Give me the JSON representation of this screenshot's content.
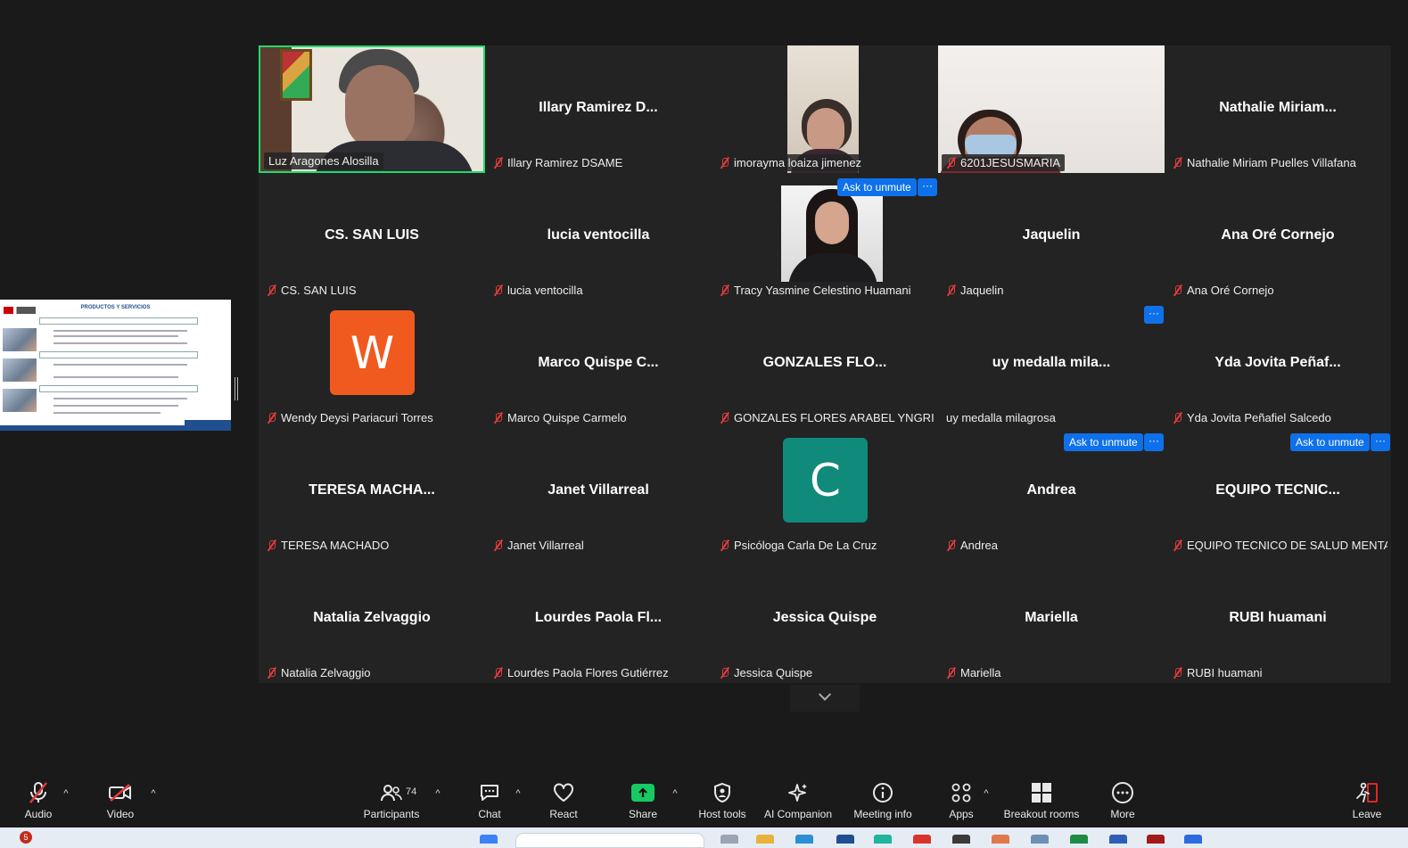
{
  "tiles": [
    {
      "big": "",
      "label": "Luz Aragones Alosilla",
      "muted": false
    },
    {
      "big": "Illary Ramirez D...",
      "label": "Illary Ramirez DSAME",
      "muted": true
    },
    {
      "big": "",
      "label": "imorayma loaiza jimenez",
      "muted": true
    },
    {
      "big": "",
      "label": "6201JESUSMARIA",
      "muted": true
    },
    {
      "big": "Nathalie Miriam...",
      "label": "Nathalie Miriam Puelles Villafana",
      "muted": true
    },
    {
      "big": "CS. SAN LUIS",
      "label": "CS. SAN LUIS",
      "muted": true
    },
    {
      "big": "lucia ventocilla",
      "label": "lucia ventocilla",
      "muted": true
    },
    {
      "big": "",
      "label": "Tracy Yasmine Celestino Huamani",
      "muted": true
    },
    {
      "big": "Jaquelin",
      "label": "Jaquelin",
      "muted": true
    },
    {
      "big": "Ana Oré Cornejo",
      "label": "Ana Oré Cornejo",
      "muted": true
    },
    {
      "big": "",
      "label": "Wendy Deysi Pariacuri Torres",
      "muted": true,
      "avatar": "W",
      "avatar_color": "#f05a1f"
    },
    {
      "big": "Marco Quispe C...",
      "label": "Marco Quispe Carmelo",
      "muted": true
    },
    {
      "big": "GONZALES   FLO...",
      "label": "GONZALES  FLORES ARABEL YNGRID",
      "muted": true
    },
    {
      "big": "uy medalla mila...",
      "label": "uy medalla milagrosa",
      "muted": false
    },
    {
      "big": "Yda Jovita Peñaf...",
      "label": "Yda Jovita Peñafiel Salcedo",
      "muted": true
    },
    {
      "big": "TERESA  MACHA...",
      "label": "TERESA MACHADO",
      "muted": true
    },
    {
      "big": "Janet Villarreal",
      "label": "Janet Villarreal",
      "muted": true
    },
    {
      "big": "",
      "label": "Psicóloga Carla De La Cruz",
      "muted": true,
      "avatar": "C",
      "avatar_color": "#0f8a7b"
    },
    {
      "big": "Andrea",
      "label": "Andrea",
      "muted": true
    },
    {
      "big": "EQUIPO TECNIC...",
      "label": "EQUIPO TECNICO DE SALUD MENTAL...",
      "muted": true
    },
    {
      "big": "Natalia Zelvaggio",
      "label": "Natalia Zelvaggio",
      "muted": true
    },
    {
      "big": "Lourdes Paola Fl...",
      "label": "Lourdes Paola Flores Gutiérrez",
      "muted": true
    },
    {
      "big": "Jessica Quispe",
      "label": "Jessica Quispe",
      "muted": true
    },
    {
      "big": "Mariella",
      "label": "Mariella",
      "muted": true
    },
    {
      "big": "RUBI huamani",
      "label": "RUBI huamani",
      "muted": true
    }
  ],
  "hover": {
    "ask_to_unmute": "Ask to unmute",
    "more": "···"
  },
  "shared_screen": {
    "title": "PRODUCTOS Y SERVICIOS"
  },
  "toolbar": {
    "audio": "Audio",
    "video": "Video",
    "participants": "Participants",
    "participants_count": "74",
    "chat": "Chat",
    "react": "React",
    "share": "Share",
    "host_tools": "Host tools",
    "ai_companion": "AI Companion",
    "meeting_info": "Meeting info",
    "apps": "Apps",
    "breakout_rooms": "Breakout rooms",
    "more": "More",
    "leave": "Leave"
  },
  "taskbar": {
    "notification_count": "5"
  },
  "colors": {
    "active_speaker": "#23d96b",
    "accent_blue": "#0e71eb",
    "share_green": "#17c964",
    "mute_red": "#e23b3b",
    "leave_red": "#e02828"
  }
}
